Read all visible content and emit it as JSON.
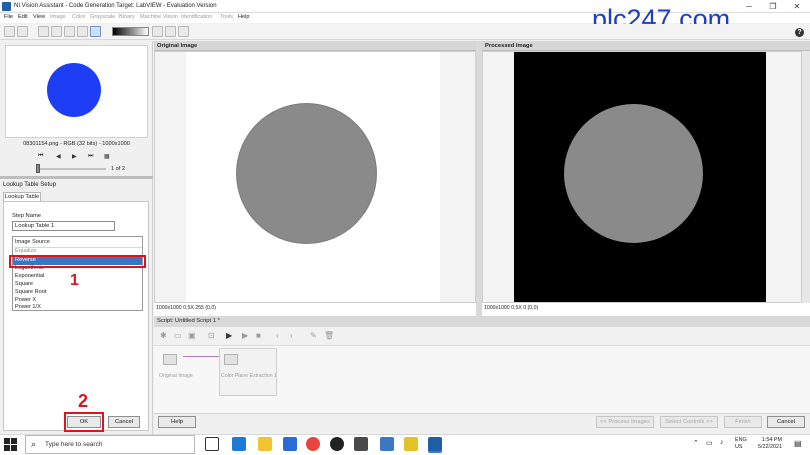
{
  "window": {
    "title": "NI Vision Assistant - Code Generation Target: LabVIEW - Evaluation Version",
    "min": "─",
    "max": "❐",
    "close": "✕"
  },
  "menu": [
    {
      "label": "File",
      "enabled": true
    },
    {
      "label": "Edit",
      "enabled": true
    },
    {
      "label": "View",
      "enabled": true
    },
    {
      "label": "Image",
      "enabled": false
    },
    {
      "label": "Color",
      "enabled": false
    },
    {
      "label": "Grayscale",
      "enabled": false
    },
    {
      "label": "Binary",
      "enabled": false
    },
    {
      "label": "Machine Vision",
      "enabled": false
    },
    {
      "label": "Identification",
      "enabled": false
    },
    {
      "label": "Tools",
      "enabled": false
    },
    {
      "label": "Help",
      "enabled": true
    }
  ],
  "watermark": "plc247.com",
  "thumbnail": {
    "info": "08301154.png - RGB (32 bits) - 1000x1000",
    "page_count": "1 of 2"
  },
  "lookup_table": {
    "header": "Lookup Table Setup",
    "tab": "Lookup Table",
    "step_name_label": "Step Name",
    "step_name_value": "Lookup Table 1",
    "image_source": "Image Source",
    "partial_label": "Equalize",
    "items": [
      "Reverse",
      "Logarithmic",
      "Exponential",
      "Square",
      "Square Root",
      "Power X",
      "Power 1/X"
    ],
    "selected": "Reverse"
  },
  "annotations": {
    "one": "1",
    "two": "2"
  },
  "buttons": {
    "ok": "OK",
    "cancel": "Cancel",
    "help": "Help",
    "process": "<< Process Images",
    "select_controls": "Select Controls >>",
    "finish": "Finish",
    "cancel_right": "Cancel"
  },
  "panes": {
    "original_title": "Original Image",
    "processed_title": "Processed Image",
    "original_stat": "1000x1000 0.5X 255      (0,0)",
    "processed_stat": "1000x1000 0.5X 0      (0,0)"
  },
  "script": {
    "title": "Script: Untitled Script 1 *",
    "steps": [
      "Original Image",
      "Color Plane Extraction 1"
    ]
  },
  "taskbar": {
    "search_placeholder": "Type here to search",
    "lang": "ENG",
    "region": "US",
    "time": "1:54 PM",
    "date": "5/22/2021"
  }
}
